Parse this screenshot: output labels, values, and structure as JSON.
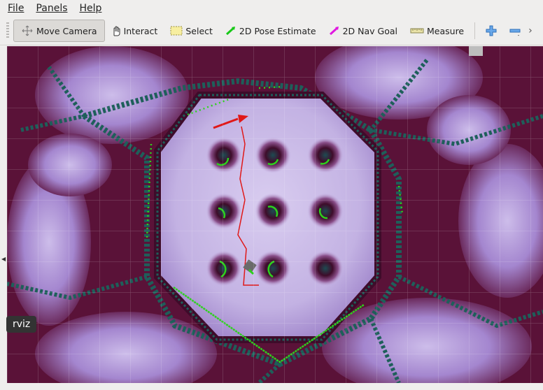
{
  "menu": {
    "file": "File",
    "panels": "Panels",
    "help": "Help"
  },
  "toolbar": {
    "move_camera": "Move Camera",
    "interact": "Interact",
    "select": "Select",
    "pose_estimate": "2D Pose Estimate",
    "nav_goal": "2D Nav Goal",
    "measure": "Measure",
    "more": "›"
  },
  "tooltip": "rviz",
  "colors": {
    "costmap_free": "#c8b8e6",
    "costmap_inflation": "#6a1a48",
    "obstacle": "#1e5f5a",
    "laser": "#2dd11c",
    "path": "#e01818",
    "pose_arrow": "#e01818",
    "pose_estimate_icon": "#18c818",
    "nav_goal_icon": "#e018e0",
    "zoom_icon": "#2f7fd8"
  },
  "icons": [
    "move-camera-icon",
    "interact-icon",
    "select-icon",
    "pose-estimate-icon",
    "nav-goal-icon",
    "measure-icon",
    "zoom-in-icon",
    "zoom-out-icon"
  ]
}
